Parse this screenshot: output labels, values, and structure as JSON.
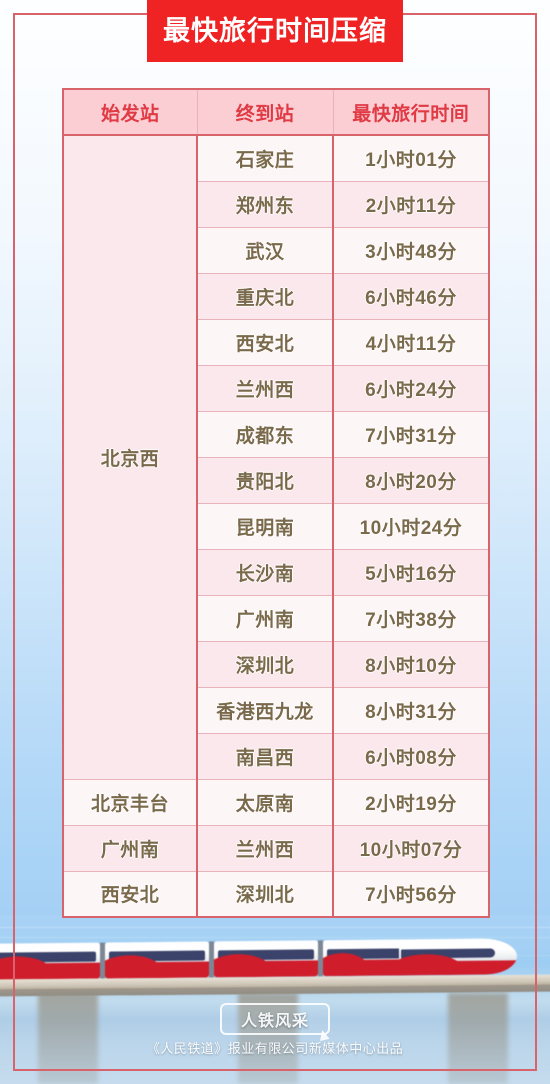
{
  "poster": {
    "title": "最快旅行时间压缩",
    "accent_red": "#ef2224",
    "frame_color": "#d9636b",
    "header_bg": "#fbced4",
    "header_text_color": "#e03a45",
    "cell_text_color": "#7a6a4b"
  },
  "table": {
    "columns": [
      "始发站",
      "终到站",
      "最快旅行时间"
    ],
    "groups": [
      {
        "origin": "北京西",
        "rows": [
          {
            "destination": "石家庄",
            "duration": "1小时01分"
          },
          {
            "destination": "郑州东",
            "duration": "2小时11分"
          },
          {
            "destination": "武汉",
            "duration": "3小时48分"
          },
          {
            "destination": "重庆北",
            "duration": "6小时46分"
          },
          {
            "destination": "西安北",
            "duration": "4小时11分"
          },
          {
            "destination": "兰州西",
            "duration": "6小时24分"
          },
          {
            "destination": "成都东",
            "duration": "7小时31分"
          },
          {
            "destination": "贵阳北",
            "duration": "8小时20分"
          },
          {
            "destination": "昆明南",
            "duration": "10小时24分"
          },
          {
            "destination": "长沙南",
            "duration": "5小时16分"
          },
          {
            "destination": "广州南",
            "duration": "7小时38分"
          },
          {
            "destination": "深圳北",
            "duration": "8小时10分"
          },
          {
            "destination": "香港西九龙",
            "duration": "8小时31分"
          },
          {
            "destination": "南昌西",
            "duration": "6小时08分"
          }
        ]
      },
      {
        "origin": "北京丰台",
        "rows": [
          {
            "destination": "太原南",
            "duration": "2小时19分"
          }
        ]
      },
      {
        "origin": "广州南",
        "rows": [
          {
            "destination": "兰州西",
            "duration": "10小时07分"
          }
        ]
      },
      {
        "origin": "西安北",
        "rows": [
          {
            "destination": "深圳北",
            "duration": "7小时56分"
          }
        ]
      }
    ]
  },
  "photo": {
    "subject": "high-speed-train-on-viaduct"
  },
  "watermark": {
    "label": "人铁风采"
  },
  "footer": {
    "credit": "《人民铁道》报业有限公司新媒体中心出品"
  }
}
